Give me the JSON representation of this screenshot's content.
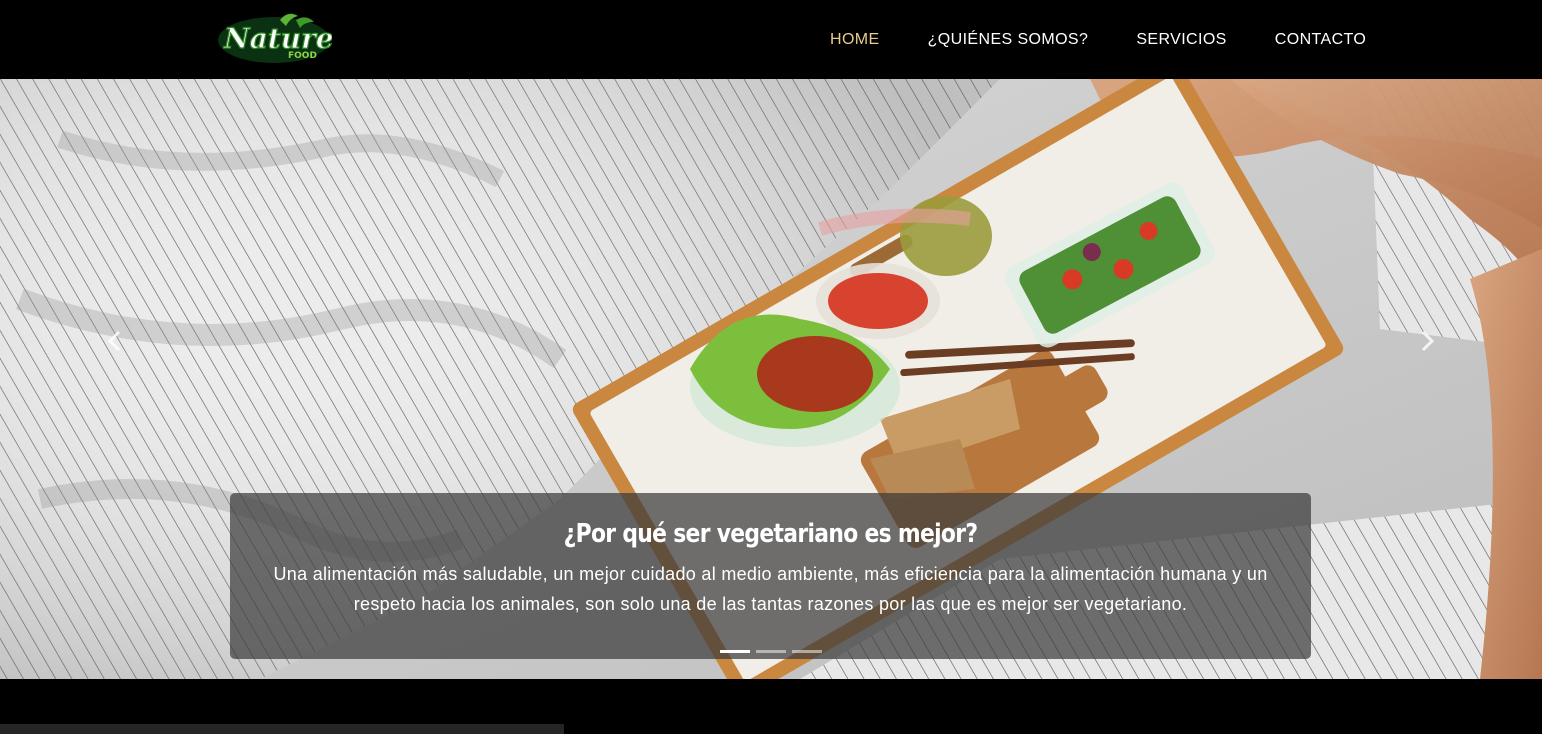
{
  "brand": {
    "logo_name": "nature-food-logo",
    "logo_text_main": "Nature",
    "logo_text_sub": "FOOD"
  },
  "nav": {
    "items": [
      {
        "label": "HOME",
        "active": true
      },
      {
        "label": "¿QUIÉNES SOMOS?",
        "active": false
      },
      {
        "label": "SERVICIOS",
        "active": false
      },
      {
        "label": "CONTACTO",
        "active": false
      }
    ]
  },
  "carousel": {
    "slide_count": 3,
    "active_slide": 1,
    "caption": {
      "title": "¿Por qué ser vegetariano es mejor?",
      "text": "Una alimentación más saludable, un mejor cuidado al medio ambiente, más eficiencia para la alimentación humana y un respeto hacia los animales, son solo una de las tantas razones por las que es mejor ser vegetariano."
    },
    "prev_icon": "chevron-left-icon",
    "next_icon": "chevron-right-icon"
  },
  "colors": {
    "nav_bg": "#000000",
    "nav_active": "#e8cc8e",
    "nav_text": "#ffffff",
    "caption_bg": "rgba(60,60,60,0.72)"
  }
}
